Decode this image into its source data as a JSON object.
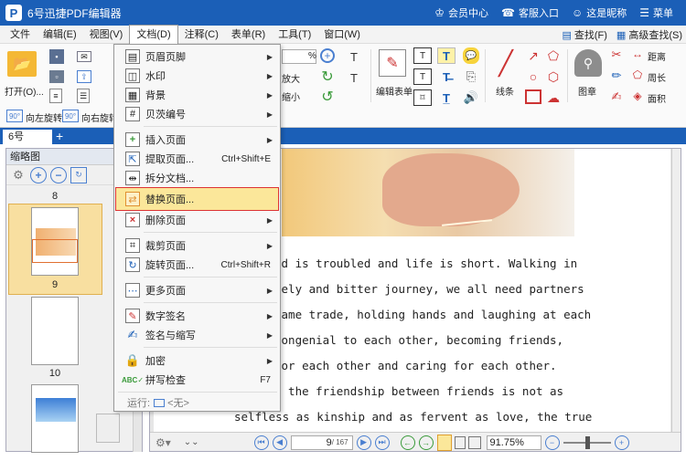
{
  "window": {
    "title": "6号迅捷PDF编辑器",
    "logo_letter": "P",
    "right_buttons": [
      "会员中心",
      "客服入口",
      "这是昵称",
      "菜单"
    ]
  },
  "menubar": {
    "items": [
      "文件",
      "编辑(E)",
      "视图(V)",
      "文档(D)",
      "注释(C)",
      "表单(R)",
      "工具(T)",
      "窗口(W)"
    ],
    "right": [
      "查找(F)",
      "高级查找(S)"
    ]
  },
  "ribbon": {
    "open_label": "打开(O)...",
    "zoom_value": "%",
    "zoom_in_label": "放大",
    "zoom_out_label": "缩小",
    "edit_form_label": "编辑表单",
    "line_label": "线条",
    "stamp_label": "图章",
    "distance_label": "距离",
    "perimeter_label": "周长",
    "area_label": "面积",
    "rotate_left_label": "向左旋转",
    "rotate_right_label": "向右旋转",
    "rotate_badge": "90°"
  },
  "tabs": {
    "doc_tab": "6号",
    "add": "+"
  },
  "thumbnails": {
    "header": "缩略图",
    "pages": [
      "8",
      "9",
      "10"
    ]
  },
  "document": {
    "lines": [
      "ld is troubled and life is short. Walking in",
      "nely and bitter journey, we all need partners",
      "same trade, holding hands and laughing at each",
      "congenial to each other, becoming friends,",
      "for each other and caring for each other.",
      "n the friendship between friends is not as",
      "selfless as kinship and as fervent as love, the true"
    ]
  },
  "statusbar": {
    "page_value": "9",
    "page_total": "/ 167",
    "zoom_value": "91.75%"
  },
  "dropdown": {
    "items": [
      {
        "label": "页眉页脚",
        "shortcut": "",
        "arrow": true
      },
      {
        "label": "水印",
        "shortcut": "",
        "arrow": true
      },
      {
        "label": "背景",
        "shortcut": "",
        "arrow": true
      },
      {
        "label": "贝茨编号",
        "shortcut": "",
        "arrow": true
      },
      {
        "label": "插入页面",
        "shortcut": "",
        "arrow": true
      },
      {
        "label": "提取页面...",
        "shortcut": "Ctrl+Shift+E",
        "arrow": false
      },
      {
        "label": "拆分文档...",
        "shortcut": "",
        "arrow": false
      },
      {
        "label": "替换页面...",
        "shortcut": "",
        "arrow": false
      },
      {
        "label": "删除页面",
        "shortcut": "",
        "arrow": true
      },
      {
        "label": "裁剪页面",
        "shortcut": "",
        "arrow": true
      },
      {
        "label": "旋转页面...",
        "shortcut": "Ctrl+Shift+R",
        "arrow": false
      },
      {
        "label": "更多页面",
        "shortcut": "",
        "arrow": true
      },
      {
        "label": "数字签名",
        "shortcut": "",
        "arrow": true
      },
      {
        "label": "签名与缩写",
        "shortcut": "",
        "arrow": true
      },
      {
        "label": "加密",
        "shortcut": "",
        "arrow": true
      },
      {
        "label": "拼写检查",
        "shortcut": "F7",
        "arrow": false
      }
    ],
    "run_label": "运行:",
    "run_value": "<无>"
  },
  "colors": {
    "brand": "#1b5fb7",
    "highlight": "#fbe79a",
    "highlight_border": "#dd3333"
  }
}
